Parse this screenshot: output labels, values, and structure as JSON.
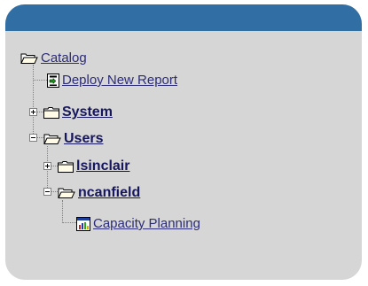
{
  "tree": {
    "root": {
      "label": "Catalog",
      "icon": "folder-open-icon"
    },
    "deploy": {
      "label": "Deploy New Report",
      "icon": "deploy-report-icon"
    },
    "system": {
      "label": "System",
      "icon": "folder-closed-icon",
      "expanded": false
    },
    "users": {
      "label": "Users",
      "icon": "folder-open-icon",
      "expanded": true
    },
    "lsinclair": {
      "label": "lsinclair",
      "icon": "folder-closed-icon",
      "expanded": false
    },
    "ncanfield": {
      "label": "ncanfield",
      "icon": "folder-open-icon",
      "expanded": true
    },
    "capacity": {
      "label": "Capacity Planning",
      "icon": "report-icon"
    }
  },
  "colors": {
    "header": "#306ea3",
    "panel": "#d6d6d6",
    "link": "#2b2b7a"
  }
}
